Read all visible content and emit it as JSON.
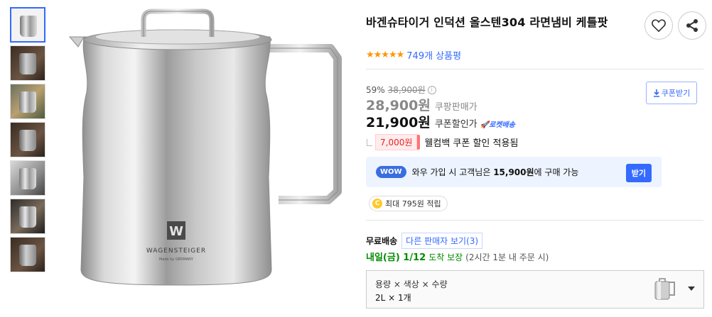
{
  "product": {
    "title": "바겐슈타이거 인덕션 올스텐304 라면냄비 케틀팟",
    "brand_logo_text": "WAGENSTEIGER",
    "brand_logo_sub": "Made by GERMANY",
    "brand_logo_mark": "W"
  },
  "rating": {
    "stars": "★★★★★",
    "count": "749개 상품평"
  },
  "pricing": {
    "discount_rate": "59%",
    "original_price": "38,900원",
    "coupang_price": "28,900원",
    "coupang_price_label": "쿠팡판매가",
    "coupon_price": "21,900원",
    "coupon_price_label": "쿠폰할인가",
    "rocket_label": "🚀로켓배송",
    "coupon_download": "쿠폰받기"
  },
  "coupon": {
    "amount": "7,000원",
    "text": "웰컴백 쿠폰 할인 적용됨"
  },
  "wow": {
    "badge": "WOW",
    "text_prefix": "와우 가입 시 고객님은 ",
    "price": "15,900원",
    "text_suffix": "에 구매 가능",
    "button": "받기"
  },
  "cashback": {
    "coin": "C",
    "text": "최대 795원 적립"
  },
  "shipping": {
    "label": "무료배송",
    "other_sellers": "다른 판매자 보기(3)",
    "arrival_date": "내일(금) 1/12",
    "arrival_guarantee": "도착 보장",
    "arrival_condition": "(2시간 1분 내 주문 시)"
  },
  "option": {
    "labels": "용량 × 색상 × 수량",
    "value": "2L × 1개"
  },
  "icons": {
    "wishlist": "heart-icon",
    "share": "share-icon",
    "download": "download-icon",
    "caret": "chevron-down-icon"
  },
  "colors": {
    "accent": "#346aff",
    "star": "#ff9600",
    "coupon_red": "#e52528",
    "arrival_green": "#008c00",
    "wow_bg": "#edf4ff"
  }
}
